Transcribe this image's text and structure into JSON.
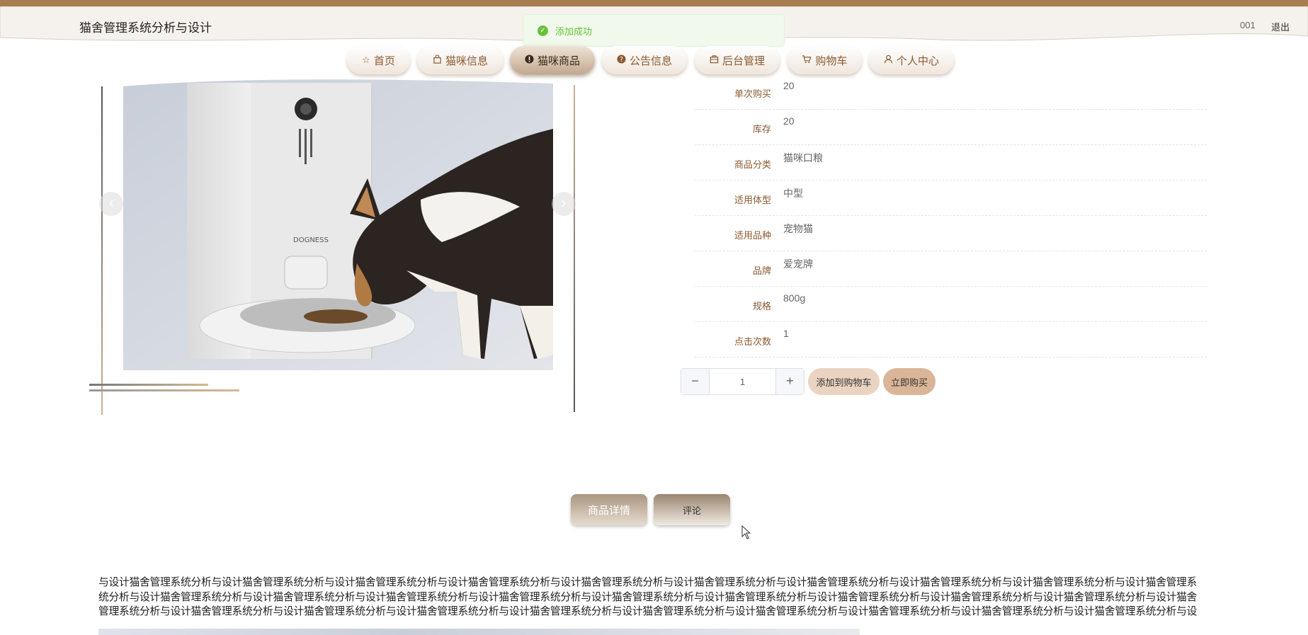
{
  "header": {
    "site_title": "猫舍管理系统分析与设计",
    "user_id": "001",
    "logout_label": "退出"
  },
  "toast": {
    "message": "添加成功"
  },
  "nav": {
    "items": [
      {
        "label": "首页",
        "icon": "star-icon"
      },
      {
        "label": "猫咪信息",
        "icon": "bag-icon"
      },
      {
        "label": "猫咪商品",
        "icon": "exclamation-circle-icon",
        "active": true
      },
      {
        "label": "公告信息",
        "icon": "question-circle-icon"
      },
      {
        "label": "后台管理",
        "icon": "box-icon"
      },
      {
        "label": "购物车",
        "icon": "cart-icon"
      },
      {
        "label": "个人中心",
        "icon": "user-icon"
      }
    ]
  },
  "gallery": {
    "image_brand_text": "DOGNESS"
  },
  "specs": [
    {
      "label": "单次购买",
      "value": "20"
    },
    {
      "label": "库存",
      "value": "20"
    },
    {
      "label": "商品分类",
      "value": "猫咪口粮"
    },
    {
      "label": "适用体型",
      "value": "中型"
    },
    {
      "label": "适用品种",
      "value": "宠物猫"
    },
    {
      "label": "品牌",
      "value": "爱宠牌"
    },
    {
      "label": "规格",
      "value": "800g"
    },
    {
      "label": "点击次数",
      "value": "1"
    }
  ],
  "purchase": {
    "quantity": "1",
    "add_to_cart_label": "添加到购物车",
    "buy_now_label": "立即购买"
  },
  "tabs": {
    "detail_label": "商品详情",
    "comment_label": "评论"
  },
  "description": {
    "text": "与设计猫舍管理系统分析与设计猫舍管理系统分析与设计猫舍管理系统分析与设计猫舍管理系统分析与设计猫舍管理系统分析与设计猫舍管理系统分析与设计猫舍管理系统分析与设计猫舍管理系统分析与设计猫舍管理系统分析与设计猫舍管理系统分析与设计猫舍管理系统分析与设计猫舍管理系统分析与设计猫舍管理系统分析与设计猫舍管理系统分析与设计猫舍管理系统分析与设计猫舍管理系统分析与设计猫舍管理系统分析与设计猫舍管理系统分析与设计猫舍管理系统分析与设计猫舍管理系统分析与设计猫舍管理系统分析与设计猫舍管理系统分析与设计猫舍管理系统分析与设计猫舍管理系统分析与设计猫舍管理系统分析与设计猫舍管理系统分析与设计猫舍管理系统分析与设计猫舍管理系统分析与设计猫舍管理系统分析与设计猫舍管理系统分析与设计猫舍管理系统分析与设计猫舍管理系统分析与"
  },
  "colors": {
    "accent": "#a87d4f",
    "nav_text": "#8a5a30",
    "success": "#67c23a"
  }
}
